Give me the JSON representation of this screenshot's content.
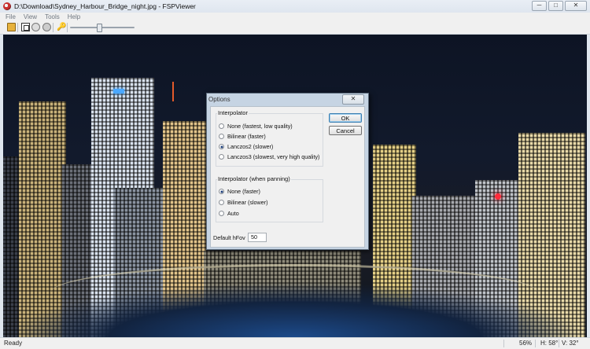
{
  "window": {
    "title": "D:\\Download\\Sydney_Harbour_Bridge_night.jpg - FSPViewer",
    "buttons": {
      "minimize": "─",
      "maximize": "□",
      "close": "✕"
    }
  },
  "menu": [
    "File",
    "View",
    "Tools",
    "Help"
  ],
  "toolbar": {
    "icons": [
      "open-icon",
      "fullscreen-icon",
      "circle-icon",
      "circle-icon",
      "key-icon"
    ],
    "zoom_slider": 0.45
  },
  "status": {
    "left": "Ready",
    "zoom": "56%",
    "hfov": "H: 58°",
    "vfov": "V: 32°"
  },
  "dialog": {
    "title": "Options",
    "close": "✕",
    "interpolator": {
      "label": "Interpolator",
      "options": [
        "None (fastest, low quality)",
        "Bilinear (faster)",
        "Lanczos2 (slower)",
        "Lanczos3 (slowest, very high quality)"
      ],
      "selected": 2
    },
    "panning": {
      "label": "Interpolator (when panning)",
      "options": [
        "None (faster)",
        "Bilinear (slower)",
        "Auto"
      ],
      "selected": 0
    },
    "hfov_label": "Default hFov",
    "hfov_value": "50",
    "ok": "OK",
    "cancel": "Cancel"
  },
  "colors": {
    "sky": "#0d1424",
    "lights": "#f1c75a",
    "dialog_frame": "#c6d4e3"
  }
}
